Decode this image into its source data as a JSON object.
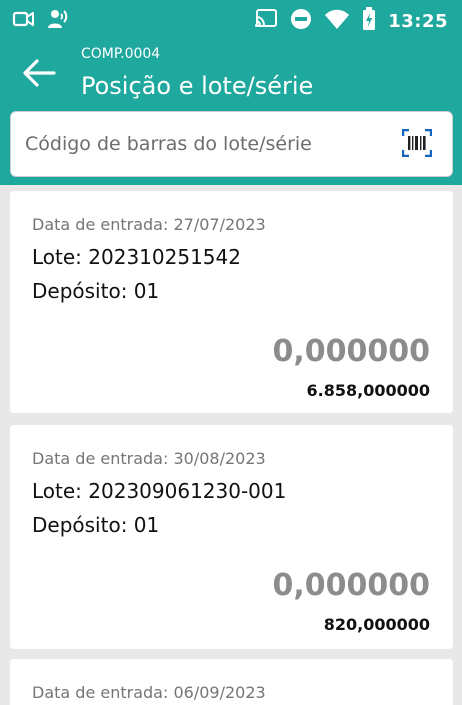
{
  "status_bar": {
    "time": "13:25",
    "left_icons": [
      "camera-icon",
      "voice-icon"
    ],
    "right_icons": [
      "cast-icon",
      "do-not-disturb-icon",
      "wifi-icon",
      "battery-icon"
    ]
  },
  "header": {
    "subtitle": "COMP.0004",
    "title": "Posição e lote/série",
    "back_icon": "arrow-left-icon"
  },
  "search": {
    "placeholder": "Código de barras do lote/série",
    "value": "",
    "scan_icon": "barcode-scan-icon"
  },
  "lots": [
    {
      "date": "Data de entrada: 27/07/2023",
      "lote": "Lote: 202310251542",
      "deposito": "Depósito: 01",
      "quantity": "0,000000",
      "total": "6.858,000000"
    },
    {
      "date": "Data de entrada: 30/08/2023",
      "lote": "Lote: 202309061230-001",
      "deposito": "Depósito: 01",
      "quantity": "0,000000",
      "total": "820,000000"
    },
    {
      "date": "Data de entrada: 06/09/2023"
    }
  ],
  "colors": {
    "primary": "#1fa89e",
    "background": "#e8e8e8",
    "quantity_text": "#8c8c8c",
    "scan_accent": "#1565c0"
  }
}
